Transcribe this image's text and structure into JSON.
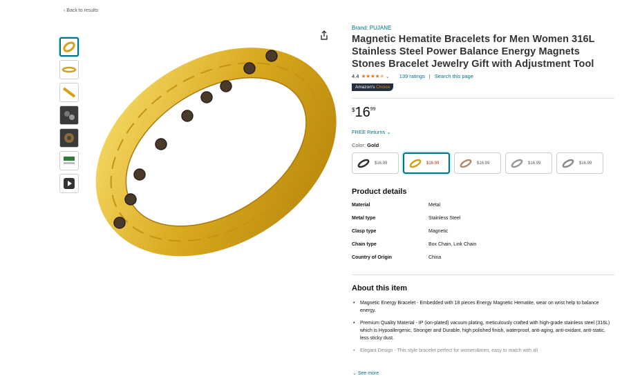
{
  "nav": {
    "back_label": "‹ Back to results"
  },
  "product": {
    "brand": "Brand: PUJANE",
    "title": "Magnetic Hematite Bracelets for Men Women 316L Stainless Steel Power Balance Energy Magnets Stones Bracelet Jewelry Gift with Adjustment Tool",
    "rating": "4.4",
    "rating_value": 4.4,
    "ratings_count": "139 ratings",
    "separator": "|",
    "search_page": "Search this page",
    "badge_prefix": "Amazon's ",
    "badge_suffix": "Choice",
    "price_symbol": "$",
    "price_whole": "16",
    "price_fraction": "99",
    "returns": "FREE Returns",
    "color_label": "Color:",
    "color_value": "Gold"
  },
  "thumbnails": [
    {
      "icon": "bracelet-gold-icon",
      "active": true
    },
    {
      "icon": "bracelet-flat-icon",
      "active": false
    },
    {
      "icon": "bracelet-angle-icon",
      "active": false
    },
    {
      "icon": "magnet-closeup-icon",
      "active": false
    },
    {
      "icon": "texture-closeup-icon",
      "active": false
    },
    {
      "icon": "size-chart-icon",
      "active": false
    },
    {
      "icon": "video-icon",
      "active": false
    }
  ],
  "swatches": [
    {
      "price": "$16.99",
      "color": "#2b2b2b",
      "selected": false
    },
    {
      "price": "$16.99",
      "color": "#d4a017",
      "selected": true
    },
    {
      "price": "$16.99",
      "color": "#b08a6a",
      "selected": false
    },
    {
      "price": "$16.99",
      "color": "#999999",
      "selected": false
    },
    {
      "price": "$16.99",
      "color": "#8a8a8a",
      "selected": false
    }
  ],
  "details": {
    "title": "Product details",
    "rows": [
      {
        "key": "Material",
        "value": "Metal"
      },
      {
        "key": "Metal type",
        "value": "Stainless Steel"
      },
      {
        "key": "Clasp type",
        "value": "Magnetic"
      },
      {
        "key": "Chain type",
        "value": "Box Chain, Link Chain"
      },
      {
        "key": "Country of Origin",
        "value": "China"
      }
    ]
  },
  "about": {
    "title": "About this item",
    "items": [
      "Magnetic Energy Bracelet - Embedded with 18 pieces Energy Magnetic Hematite, wear on wrist help to balance energy.",
      "Premium Quality Material - IP (ion-plated) vacuum plating, meticulously crafted with high-grade stainless steel (316L) which is Hypoallergenic, Stronger and Durable, high polished finish, waterproof, anti-aging, anti-oxidant, anti-static, less sticky dust.",
      "Elegant Design - This style bracelet perfect for women&men, easy to match with all"
    ],
    "see_more": "See more"
  },
  "colors": {
    "link": "#007185",
    "star": "#de7921",
    "gold": "#d4a017",
    "badge_bg": "#232f3e"
  }
}
